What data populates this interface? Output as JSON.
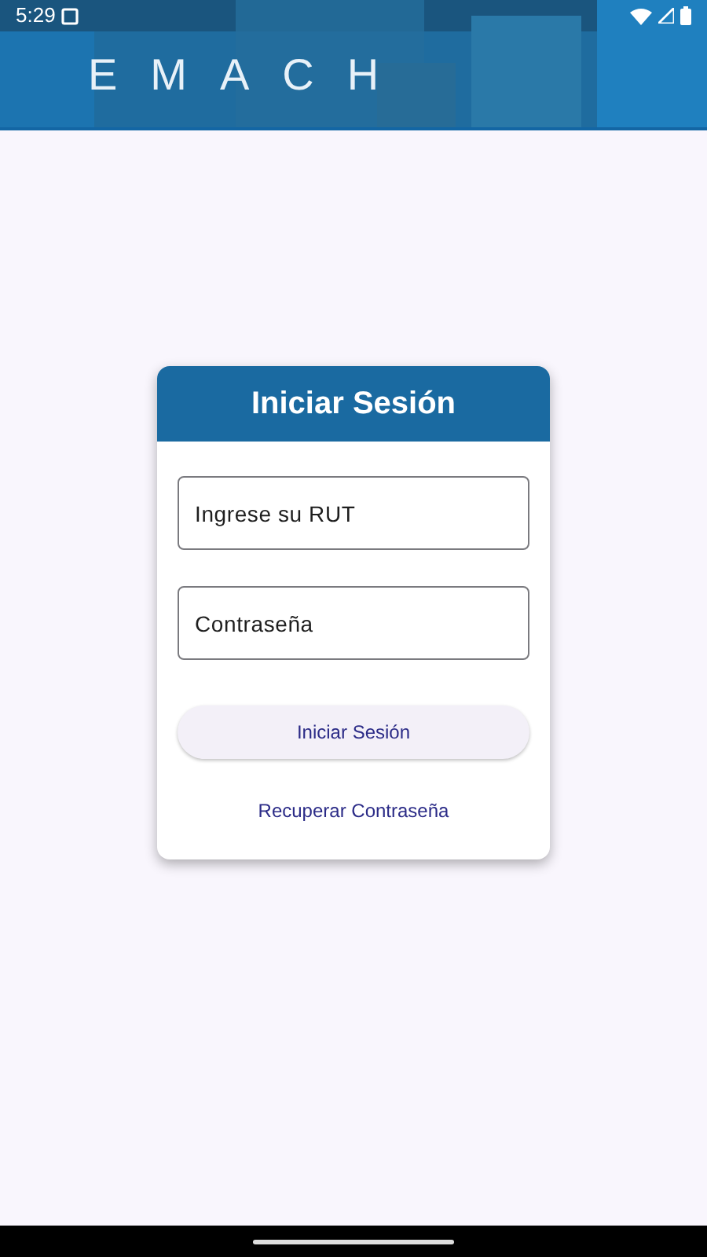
{
  "status_bar": {
    "time": "5:29"
  },
  "header": {
    "logo": "EMACH"
  },
  "login": {
    "title": "Iniciar Sesión",
    "fields": [
      {
        "placeholder": "Ingrese su RUT"
      },
      {
        "placeholder": "Contraseña"
      }
    ],
    "submit": "Iniciar Sesión",
    "recover_link": "Recuperar Contraseña"
  }
}
